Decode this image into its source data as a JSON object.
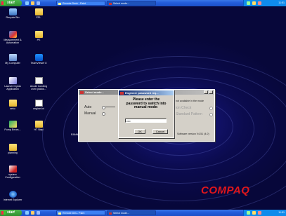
{
  "taskbar_top": {
    "start_label": "start",
    "tasks": [
      {
        "label": "Remote Desk - Paint",
        "active": false
      },
      {
        "label": "Select mode...",
        "active": true
      }
    ],
    "clock": "11:51"
  },
  "taskbar_bottom": {
    "start_label": "start",
    "tasks": [
      {
        "label": "Remote Des - Paint",
        "active": false
      },
      {
        "label": "Select mode...",
        "active": true
      }
    ],
    "clock": "11:51"
  },
  "desktop_icons": [
    {
      "label": "Recycle Bin",
      "icon": "recycle-bin-icon"
    },
    {
      "label": "EPL",
      "icon": "folder-icon"
    },
    {
      "label": "Measurement & Automation",
      "icon": "measurement-icon"
    },
    {
      "label": "PE",
      "icon": "folder-icon"
    },
    {
      "label": "My Computer",
      "icon": "computer-icon"
    },
    {
      "label": "TeamViewer 8",
      "icon": "teamviewer-icon"
    },
    {
      "label": "Launch Crysta Application",
      "icon": "crysta-icon"
    },
    {
      "label": "Anode bonding oven platos...",
      "icon": "document-icon"
    },
    {
      "label": "seku",
      "icon": "folder-icon"
    },
    {
      "label": "engine.txt",
      "icon": "text-file-icon"
    },
    {
      "label": "Pump Errors...",
      "icon": "pump-icon"
    },
    {
      "label": "HT Step",
      "icon": "folder-icon"
    },
    {
      "label": "planning",
      "icon": "folder-icon"
    },
    {
      "label": "system Configuration",
      "icon": "config-icon"
    },
    {
      "label": "Internet Explorer",
      "icon": "ie-icon"
    }
  ],
  "brand": "COMPAQ",
  "select_mode_window": {
    "title": "Select mode...",
    "auto_label": "Auto",
    "manual_label": "Manual",
    "info_text": "not available in the mode",
    "option1": "ion Check",
    "option2": "Standard Pattern",
    "version": "Software version V4.51 (4.0)"
  },
  "password_dialog": {
    "title": "Engineer password req...",
    "message": "Please enter the password to switch into manual mode:",
    "password_value": "****",
    "ok_label": "OK",
    "cancel_label": "Cancel"
  },
  "partial_label": "RANN"
}
